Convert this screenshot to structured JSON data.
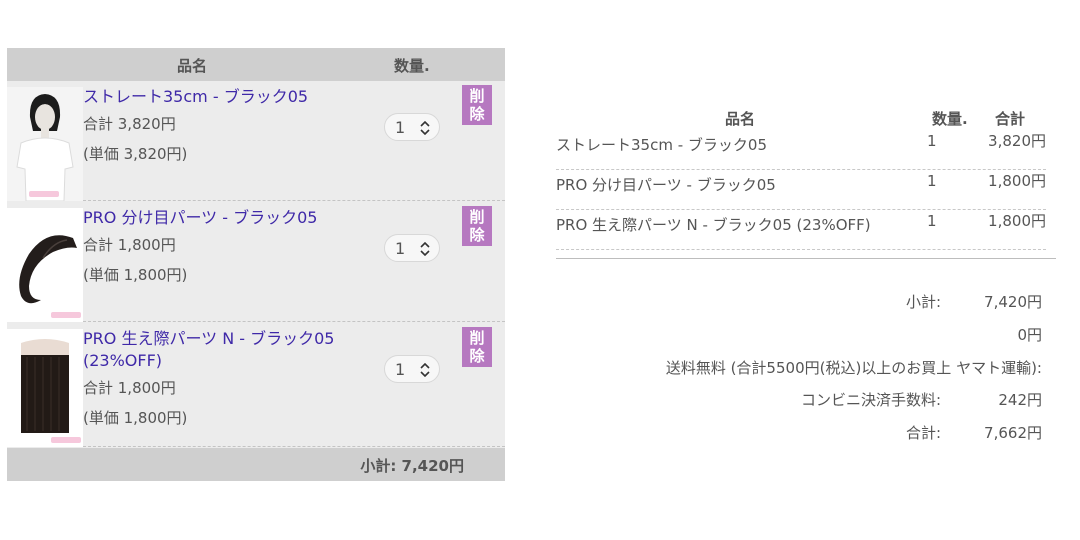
{
  "cart": {
    "header": {
      "name": "品名",
      "qty": "数量."
    },
    "items": [
      {
        "title": "ストレート35cm - ブラック05",
        "subtotal": "合計 3,820円",
        "unit": "(単価 3,820円)",
        "qty": "1",
        "delete": "削除",
        "thumb_icon": "wig-mannequin-image"
      },
      {
        "title": "PRO 分け目パーツ - ブラック05",
        "subtotal": "合計 1,800円",
        "unit": "(単価 1,800円)",
        "qty": "1",
        "delete": "削除",
        "thumb_icon": "hair-part-image"
      },
      {
        "title": "PRO 生え際パーツ N - ブラック05 (23%OFF)",
        "subtotal": "合計 1,800円",
        "unit": "(単価 1,800円)",
        "qty": "1",
        "delete": "削除",
        "thumb_icon": "hair-extension-image"
      }
    ],
    "footer": {
      "subtotal": "小計: 7,420円"
    }
  },
  "summary": {
    "header": {
      "name": "品名",
      "qty": "数量.",
      "total": "合計"
    },
    "lines": [
      {
        "name": "ストレート35cm - ブラック05",
        "qty": "1",
        "total": "3,820円"
      },
      {
        "name": "PRO 分け目パーツ - ブラック05",
        "qty": "1",
        "total": "1,800円"
      },
      {
        "name": "PRO 生え際パーツ N - ブラック05 (23%OFF)",
        "qty": "1",
        "total": "1,800円"
      }
    ],
    "totals": [
      {
        "label": "小計:",
        "value": "7,420円"
      },
      {
        "label": "",
        "value": "0円"
      },
      {
        "label": "送料無料 (合計5500円(税込)以上のお買上 ヤマト運輸):",
        "value": ""
      },
      {
        "label": "コンビニ決済手数料:",
        "value": "242円"
      },
      {
        "label": "合計:",
        "value": "7,662円"
      }
    ]
  },
  "colors": {
    "link": "#3f29a8",
    "delete_bg": "#b678c0",
    "header_bg": "#cfcfcf",
    "panel_bg": "#ececec"
  }
}
